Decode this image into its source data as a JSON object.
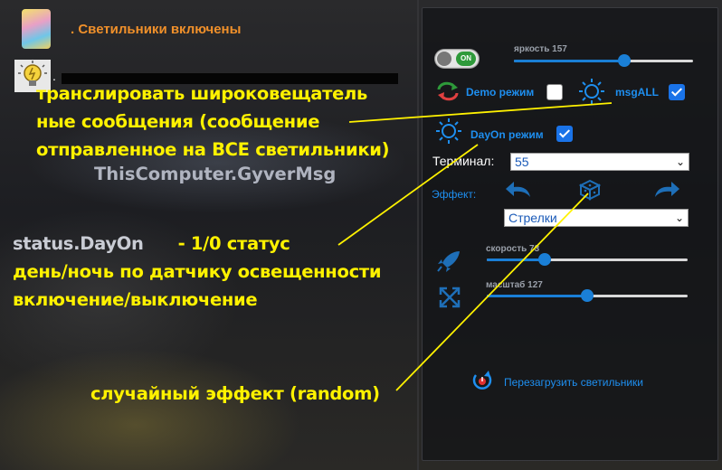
{
  "header": {
    "status_text": ". Светильники включены",
    "dot": "."
  },
  "annotations": {
    "broadcast_lines": [
      "транслировать широковещатель",
      "ные сообщения (сообщение",
      "отправленное на ВСЕ светильники)"
    ],
    "gyver_msg": "ThisComputer.GyverMsg",
    "dayon_key": "status.DayOn",
    "dayon_dash": "- 1/0 статус",
    "dayon_lines": [
      "день/ночь по датчику освещенности",
      "включение/выключение"
    ],
    "random": "случайный эффект (random)"
  },
  "panel": {
    "toggle_label": "ON",
    "toggle_on": true,
    "brightness": {
      "label": "яркость 157",
      "value": 157,
      "max": 255
    },
    "demo_label": "Demo режим",
    "demo_checked": false,
    "msgall_label": "msgALL",
    "msgall_checked": true,
    "dayon_label": "DayOn режим",
    "dayon_checked": true,
    "terminal_label": "Терминал:",
    "terminal_value": "55",
    "effect_label": "Эффект:",
    "effect_value": "Стрелки",
    "speed": {
      "label": "скорость 73",
      "value": 73,
      "max": 255
    },
    "scale": {
      "label": "масштаб 127",
      "value": 127,
      "max": 255
    },
    "reload_label": "Перезагрузить светильники"
  },
  "colors": {
    "accent": "#1e8ff0",
    "annotation": "#fff200",
    "status": "#f0902a",
    "slider": "#1a7fd6"
  }
}
